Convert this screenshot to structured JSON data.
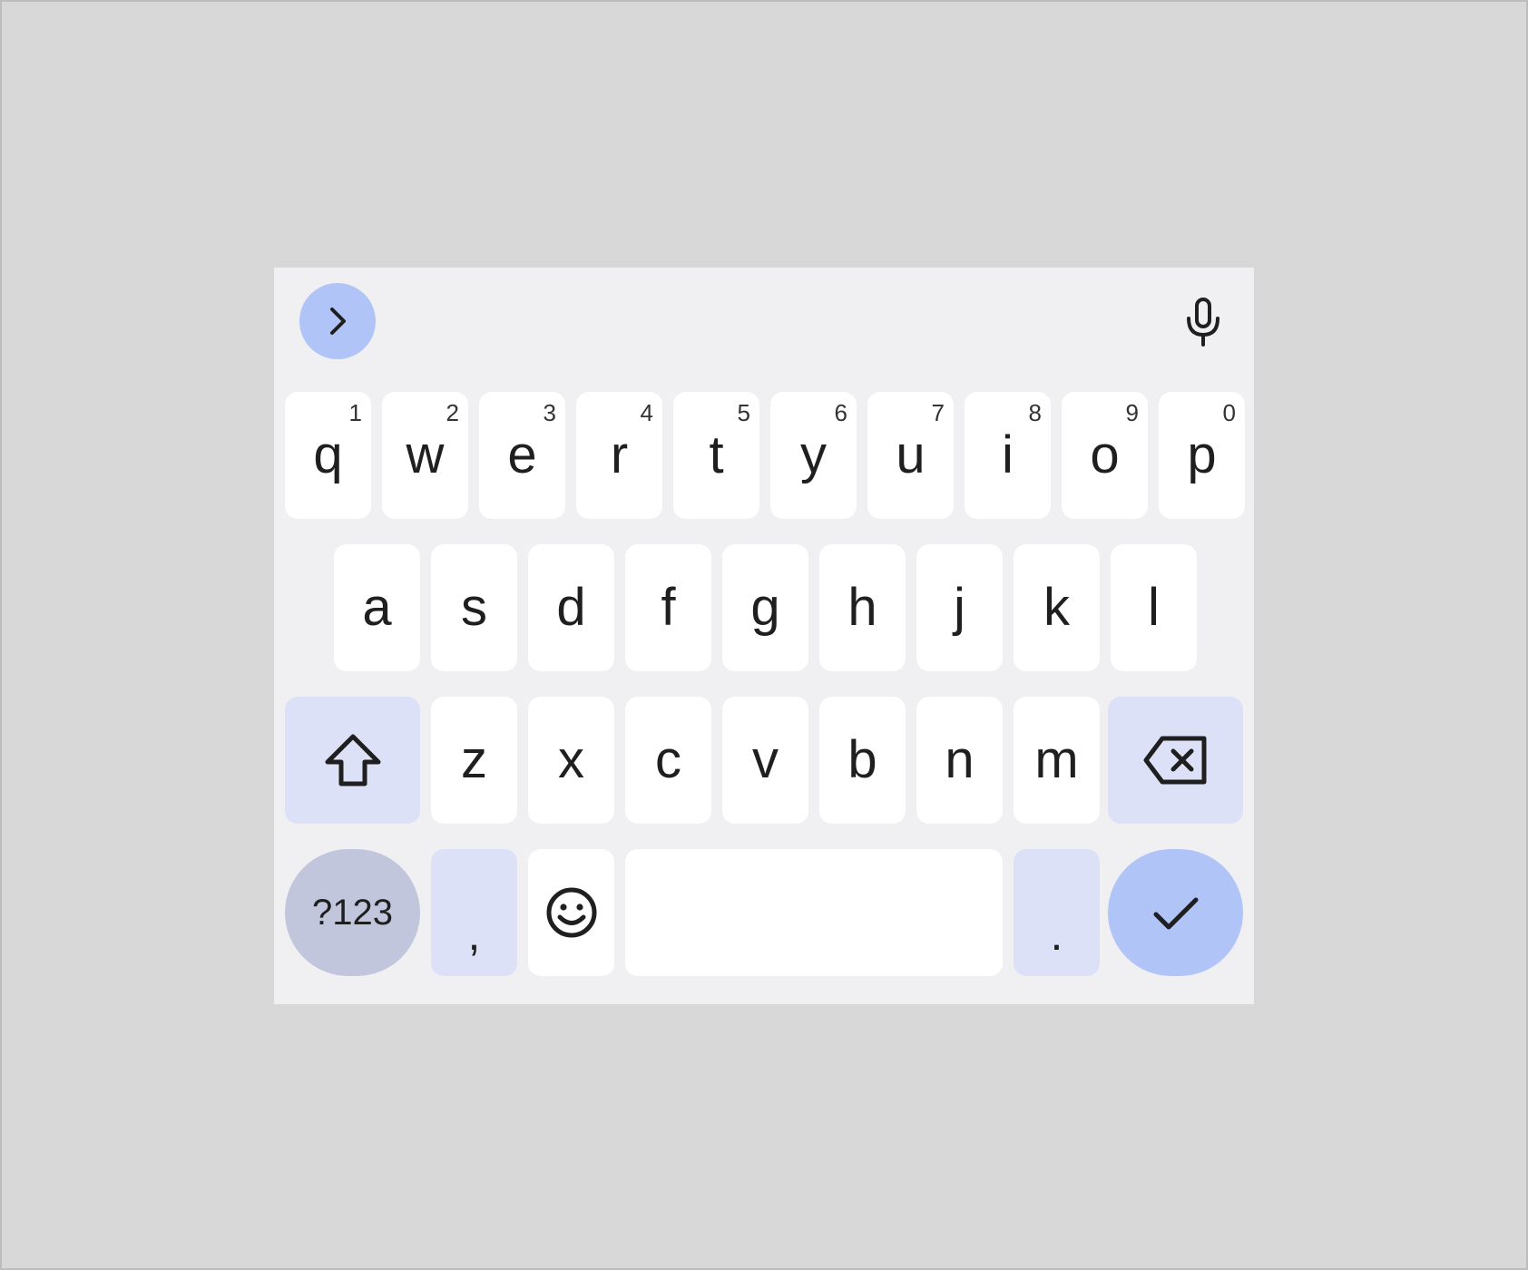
{
  "toolbar": {
    "expand_icon": "chevron-right-icon",
    "mic_icon": "microphone-icon"
  },
  "rows": [
    [
      {
        "label": "q",
        "hint": "1"
      },
      {
        "label": "w",
        "hint": "2"
      },
      {
        "label": "e",
        "hint": "3"
      },
      {
        "label": "r",
        "hint": "4"
      },
      {
        "label": "t",
        "hint": "5"
      },
      {
        "label": "y",
        "hint": "6"
      },
      {
        "label": "u",
        "hint": "7"
      },
      {
        "label": "i",
        "hint": "8"
      },
      {
        "label": "o",
        "hint": "9"
      },
      {
        "label": "p",
        "hint": "0"
      }
    ],
    [
      {
        "label": "a"
      },
      {
        "label": "s"
      },
      {
        "label": "d"
      },
      {
        "label": "f"
      },
      {
        "label": "g"
      },
      {
        "label": "h"
      },
      {
        "label": "j"
      },
      {
        "label": "k"
      },
      {
        "label": "l"
      }
    ],
    [
      {
        "label": "z"
      },
      {
        "label": "x"
      },
      {
        "label": "c"
      },
      {
        "label": "v"
      },
      {
        "label": "b"
      },
      {
        "label": "n"
      },
      {
        "label": "m"
      }
    ]
  ],
  "bottom": {
    "symbols_label": "?123",
    "comma_label": ",",
    "period_label": "."
  },
  "colors": {
    "background": "#d8d8d8",
    "keyboard_bg": "#f0f0f3",
    "key": "#ffffff",
    "modifier_key": "#dde1f7",
    "symbols_key": "#c1c6dd",
    "accent": "#b1c4f7"
  },
  "icons": [
    "chevron-right-icon",
    "microphone-icon",
    "shift-icon",
    "backspace-icon",
    "emoji-icon",
    "checkmark-icon"
  ]
}
